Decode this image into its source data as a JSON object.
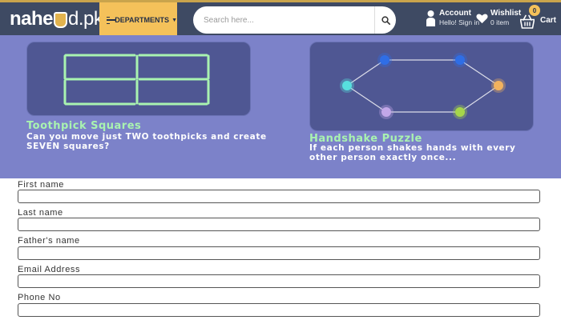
{
  "header": {
    "logo_text_a": "nahe",
    "logo_text_b": "d.pk",
    "departments_label": "DEPARTMENTS",
    "search_placeholder": "Search here...",
    "account_title": "Account",
    "account_subtitle": "Hello! Sign in",
    "wishlist_title": "Wishlist",
    "wishlist_subtitle": "0 item",
    "cart_label": "Cart",
    "cart_count": "0"
  },
  "banner": {
    "colors": {
      "background": "#7c82c9",
      "card": "#4f5793",
      "title": "#a9f3b0"
    },
    "puzzles": [
      {
        "title": "Toothpick Squares",
        "desc": "Can you move just TWO toothpicks and create SEVEN squares?"
      },
      {
        "title": "Handshake Puzzle",
        "desc": "If each person shakes hands with every other person exactly once...",
        "node_colors": [
          "#2f6ee6",
          "#2f6ee6",
          "#f2b25e",
          "#a6d64a",
          "#c2a7e8",
          "#57e0de"
        ]
      }
    ]
  },
  "form": {
    "fields": [
      {
        "label": "First name",
        "value": ""
      },
      {
        "label": "Last name",
        "value": ""
      },
      {
        "label": "Father's name",
        "value": ""
      },
      {
        "label": "Email Address",
        "value": ""
      },
      {
        "label": "Phone No",
        "value": ""
      }
    ]
  }
}
